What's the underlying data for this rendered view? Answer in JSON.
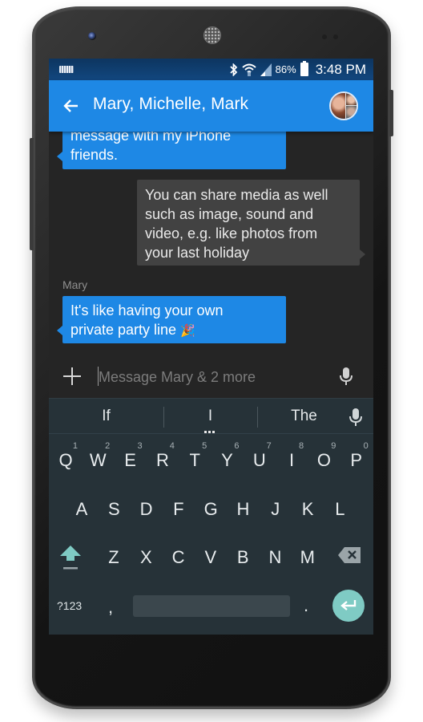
{
  "status_bar": {
    "left_icon": "keyboard-icon",
    "icons": [
      "bluetooth-icon",
      "wifi-icon",
      "signal-icon",
      "battery-icon"
    ],
    "battery_percent": "86%",
    "time": "3:48 PM"
  },
  "app_bar": {
    "back_icon": "arrow-left-icon",
    "title": "Mary, Michelle, Mark",
    "avatar": "group-avatar"
  },
  "messages": [
    {
      "direction": "incoming",
      "sender": "",
      "lines": [
        "message with my iPhone",
        "friends."
      ]
    },
    {
      "direction": "outgoing",
      "sender": "",
      "lines": [
        "You can share media as well",
        "such as image, sound and",
        "video, e.g. like photos from",
        "your last holiday"
      ]
    },
    {
      "direction": "incoming",
      "sender": "Mary",
      "lines": [
        "It's like having your own",
        "private party line"
      ],
      "emoji": "🎉"
    }
  ],
  "compose": {
    "attach_icon": "plus-icon",
    "placeholder": "Message Mary & 2 more",
    "value": "",
    "mic_icon": "microphone-icon"
  },
  "keyboard": {
    "suggestions": [
      "If",
      "I",
      "The"
    ],
    "suggestion_mic_icon": "microphone-icon",
    "row1": [
      {
        "key": "Q",
        "hint": "1"
      },
      {
        "key": "W",
        "hint": "2"
      },
      {
        "key": "E",
        "hint": "3"
      },
      {
        "key": "R",
        "hint": "4"
      },
      {
        "key": "T",
        "hint": "5"
      },
      {
        "key": "Y",
        "hint": "6"
      },
      {
        "key": "U",
        "hint": "7"
      },
      {
        "key": "I",
        "hint": "8"
      },
      {
        "key": "O",
        "hint": "9"
      },
      {
        "key": "P",
        "hint": "0"
      }
    ],
    "row2": [
      "A",
      "S",
      "D",
      "F",
      "G",
      "H",
      "J",
      "K",
      "L"
    ],
    "row3": [
      "Z",
      "X",
      "C",
      "V",
      "B",
      "N",
      "M"
    ],
    "symbols_label": "?123",
    "comma": ",",
    "period": ".",
    "accent_color": "#7fcbc4"
  },
  "colors": {
    "app_bar": "#1e88e5",
    "incoming_bubble": "#1e88e5",
    "outgoing_bubble": "#424242",
    "keyboard_bg": "#263238"
  }
}
